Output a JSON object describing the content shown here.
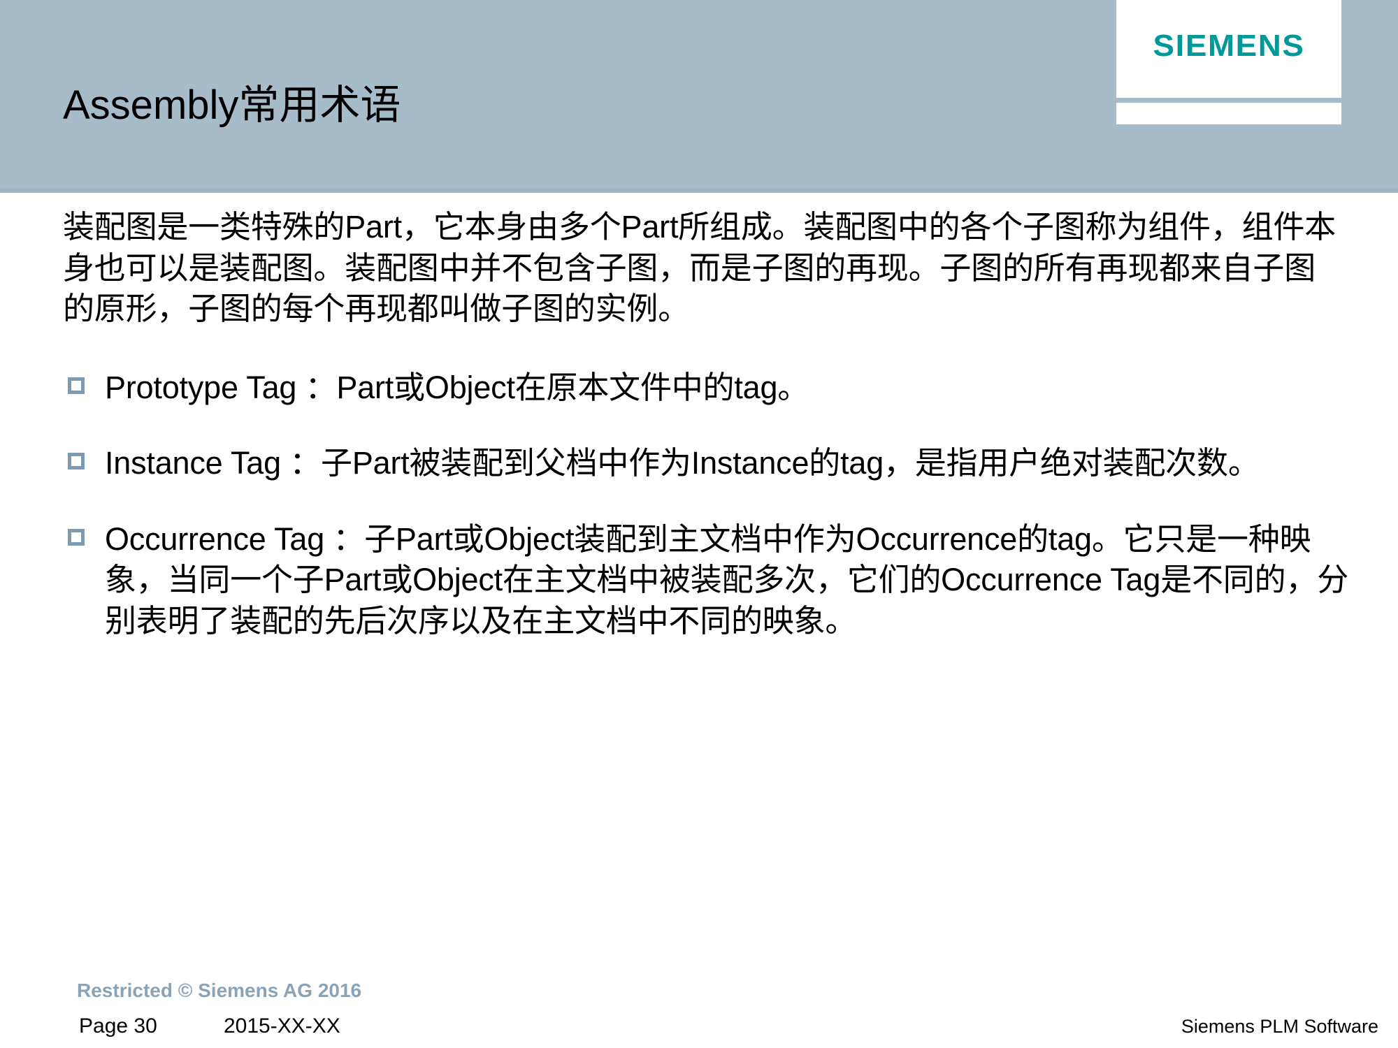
{
  "header": {
    "background_color": "#a7bcc9",
    "title": "Assembly常用术语",
    "logo": {
      "wordmark": "SIEMENS",
      "color": "#009999"
    }
  },
  "body": {
    "lead_paragraph": "装配图是一类特殊的Part，它本身由多个Part所组成。装配图中的各个子图称为组件，组件本身也可以是装配图。装配图中并不包含子图，而是子图的再现。子图的所有再现都来自子图的原形，子图的每个再现都叫做子图的实例。",
    "bullets": [
      {
        "marker": "hollow-square-bullet",
        "text": "Prototype Tag ：Part或Object在原本文件中的tag。"
      },
      {
        "marker": "hollow-square-bullet",
        "text": "Instance Tag ：子Part被装配到父档中作为Instance的tag，是指用户绝对装配次数。"
      },
      {
        "marker": "hollow-square-bullet",
        "text": "Occurrence Tag ：子Part或Object装配到主文档中作为Occurrence的tag。它只是一种映象，当同一个子Part或Object在主文档中被装配多次，它们的Occurrence Tag是不同的，分别表明了装配的先后次序以及在主文档中不同的映象。"
      }
    ],
    "bullet_marker_color": "#7e9ab0"
  },
  "footer": {
    "restricted": "Restricted © Siemens AG 2016",
    "restricted_color": "#8ba3b6",
    "page": "Page 30",
    "date": "2015-XX-XX",
    "brand": "Siemens PLM Software"
  }
}
